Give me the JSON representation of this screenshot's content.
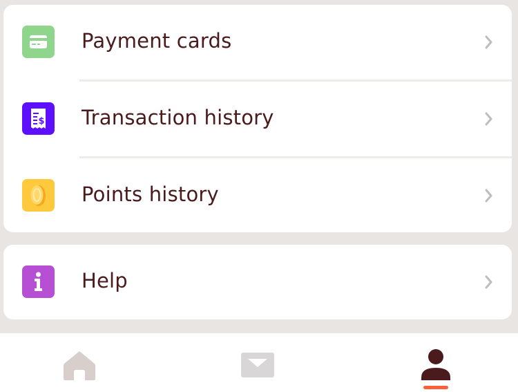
{
  "menu": {
    "items": [
      {
        "label": "Payment cards",
        "icon": "credit-card-icon",
        "icon_color": "#8fd68c"
      },
      {
        "label": "Transaction history",
        "icon": "receipt-dollar-icon",
        "icon_color": "#5d0fff"
      },
      {
        "label": "Points history",
        "icon": "coin-icon",
        "icon_color": "#ffc93d"
      }
    ]
  },
  "help": {
    "label": "Help",
    "icon": "info-icon",
    "icon_color": "#b64fd3"
  },
  "tabbar": {
    "tabs": [
      {
        "name": "home",
        "icon": "home-icon",
        "active": false
      },
      {
        "name": "inbox",
        "icon": "mail-icon",
        "active": false
      },
      {
        "name": "profile",
        "icon": "user-icon",
        "active": true
      }
    ],
    "active_color": "#ff5e3a"
  },
  "colors": {
    "text": "#4a1a1c",
    "background": "#e8e5e3",
    "chevron": "#bdbdbd"
  }
}
